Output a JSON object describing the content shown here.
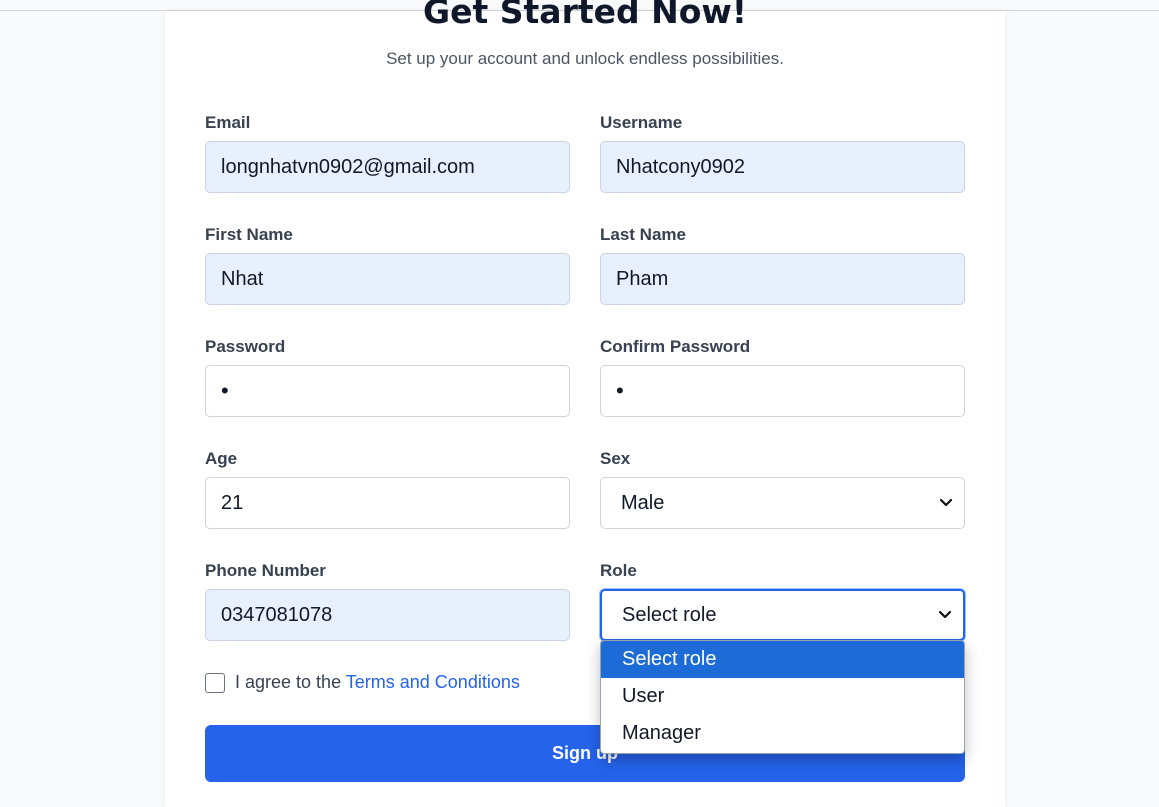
{
  "header": {
    "title": "Get Started Now!",
    "subtitle": "Set up your account and unlock endless possibilities."
  },
  "form": {
    "email": {
      "label": "Email",
      "value": "longnhatvn0902@gmail.com"
    },
    "username": {
      "label": "Username",
      "value": "Nhatcony0902"
    },
    "first_name": {
      "label": "First Name",
      "value": "Nhat"
    },
    "last_name": {
      "label": "Last Name",
      "value": "Pham"
    },
    "password": {
      "label": "Password",
      "value": "•"
    },
    "confirm_password": {
      "label": "Confirm Password",
      "value": "•"
    },
    "age": {
      "label": "Age",
      "value": "21"
    },
    "sex": {
      "label": "Sex",
      "value": "Male"
    },
    "phone": {
      "label": "Phone Number",
      "value": "0347081078"
    },
    "role": {
      "label": "Role",
      "value": "Select role",
      "options": [
        "Select role",
        "User",
        "Manager"
      ]
    }
  },
  "terms": {
    "prefix": "I agree to the ",
    "link": "Terms and Conditions"
  },
  "submit": {
    "label": "Sign up"
  },
  "colors": {
    "accent": "#2563eb",
    "filled_bg": "#e8f0fe",
    "option_selected": "#1d6bd6"
  },
  "icons": {
    "select_arrow": "chevron-down-icon"
  }
}
